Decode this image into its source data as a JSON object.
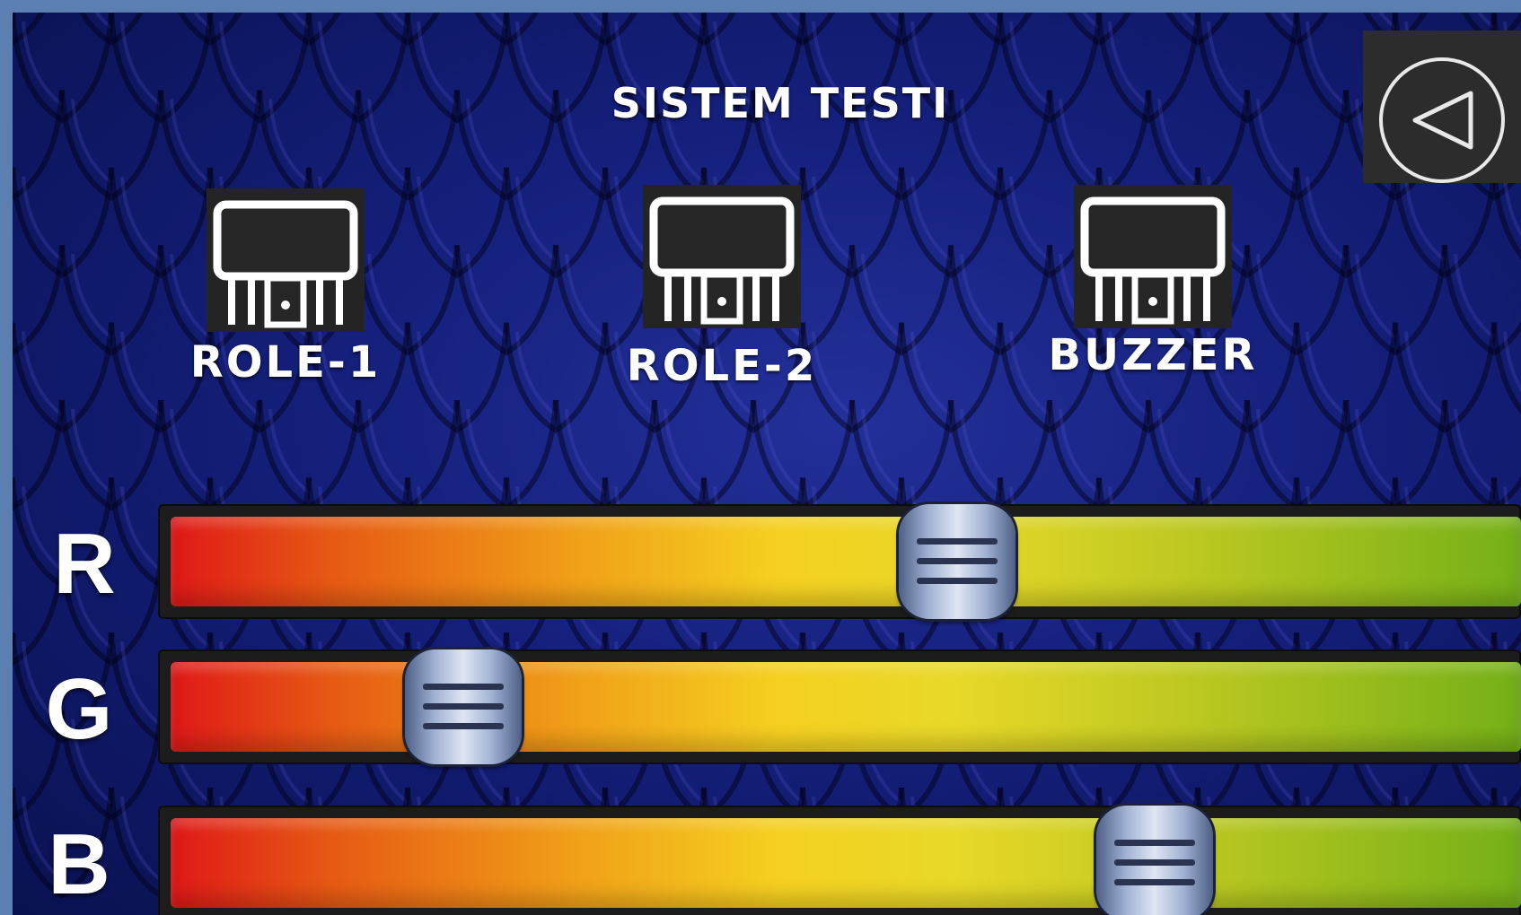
{
  "screen": {
    "title": "SISTEM TESTI"
  },
  "back_button": {
    "icon": "back-arrow-icon"
  },
  "outputs": [
    {
      "label": "ROLE-1",
      "icon": "relay-icon"
    },
    {
      "label": "ROLE-2",
      "icon": "relay-icon"
    },
    {
      "label": "BUZZER",
      "icon": "relay-icon"
    }
  ],
  "sliders": [
    {
      "channel": "R",
      "value_fraction": 0.59
    },
    {
      "channel": "G",
      "value_fraction": 0.19
    },
    {
      "channel": "B",
      "value_fraction": 0.75
    }
  ],
  "colors": {
    "background": "#141f7a",
    "gradient_start": "#e01818",
    "gradient_mid": "#f5d020",
    "gradient_end": "#74b018",
    "text": "#ffffff"
  }
}
